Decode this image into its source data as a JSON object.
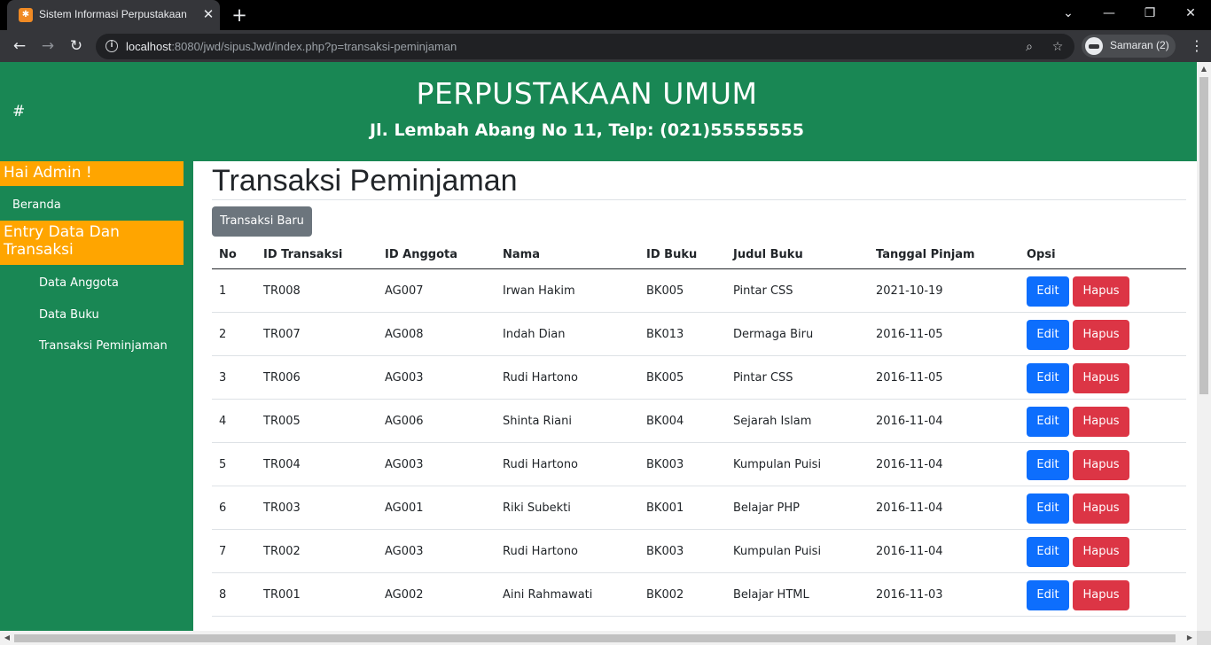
{
  "browser": {
    "tab_title": "Sistem Informasi Perpustakaan",
    "tab_favicon": "xampp-icon",
    "url_host": "localhost",
    "url_rest": ":8080/jwd/sipusJwd/index.php?p=transaksi-peminjaman",
    "profile_label": "Samaran (2)",
    "icons": {
      "back": "←",
      "forward": "→",
      "reload": "↻",
      "zoom": "⌕",
      "star": "☆",
      "menu": "⋮",
      "close": "✕",
      "new_tab": "+",
      "minimize": "—",
      "restore": "❐",
      "tab_list": "⌄",
      "info": "i"
    }
  },
  "header": {
    "hash": "#",
    "title": "PERPUSTAKAAN UMUM",
    "subtitle": "Jl. Lembah Abang No 11, Telp: (021)55555555",
    "bg_color": "#198754"
  },
  "sidebar": {
    "greeting": "Hai Admin !",
    "home_link": "Beranda",
    "section_title": "Entry Data Dan Transaksi",
    "links": [
      "Data Anggota",
      "Data Buku",
      "Transaksi Peminjaman"
    ],
    "accent_color": "#ffa500"
  },
  "main": {
    "title": "Transaksi Peminjaman",
    "new_button": "Transaksi Baru",
    "columns": [
      "No",
      "ID Transaksi",
      "ID Anggota",
      "Nama",
      "ID Buku",
      "Judul Buku",
      "Tanggal Pinjam",
      "Opsi"
    ],
    "edit_label": "Edit",
    "delete_label": "Hapus",
    "rows": [
      [
        "1",
        "TR008",
        "AG007",
        "Irwan Hakim",
        "BK005",
        "Pintar CSS",
        "2021-10-19"
      ],
      [
        "2",
        "TR007",
        "AG008",
        "Indah Dian",
        "BK013",
        "Dermaga Biru",
        "2016-11-05"
      ],
      [
        "3",
        "TR006",
        "AG003",
        "Rudi Hartono",
        "BK005",
        "Pintar CSS",
        "2016-11-05"
      ],
      [
        "4",
        "TR005",
        "AG006",
        "Shinta Riani",
        "BK004",
        "Sejarah Islam",
        "2016-11-04"
      ],
      [
        "5",
        "TR004",
        "AG003",
        "Rudi Hartono",
        "BK003",
        "Kumpulan Puisi",
        "2016-11-04"
      ],
      [
        "6",
        "TR003",
        "AG001",
        "Riki Subekti",
        "BK001",
        "Belajar PHP",
        "2016-11-04"
      ],
      [
        "7",
        "TR002",
        "AG003",
        "Rudi Hartono",
        "BK003",
        "Kumpulan Puisi",
        "2016-11-04"
      ],
      [
        "8",
        "TR001",
        "AG002",
        "Aini Rahmawati",
        "BK002",
        "Belajar HTML",
        "2016-11-03"
      ]
    ]
  }
}
